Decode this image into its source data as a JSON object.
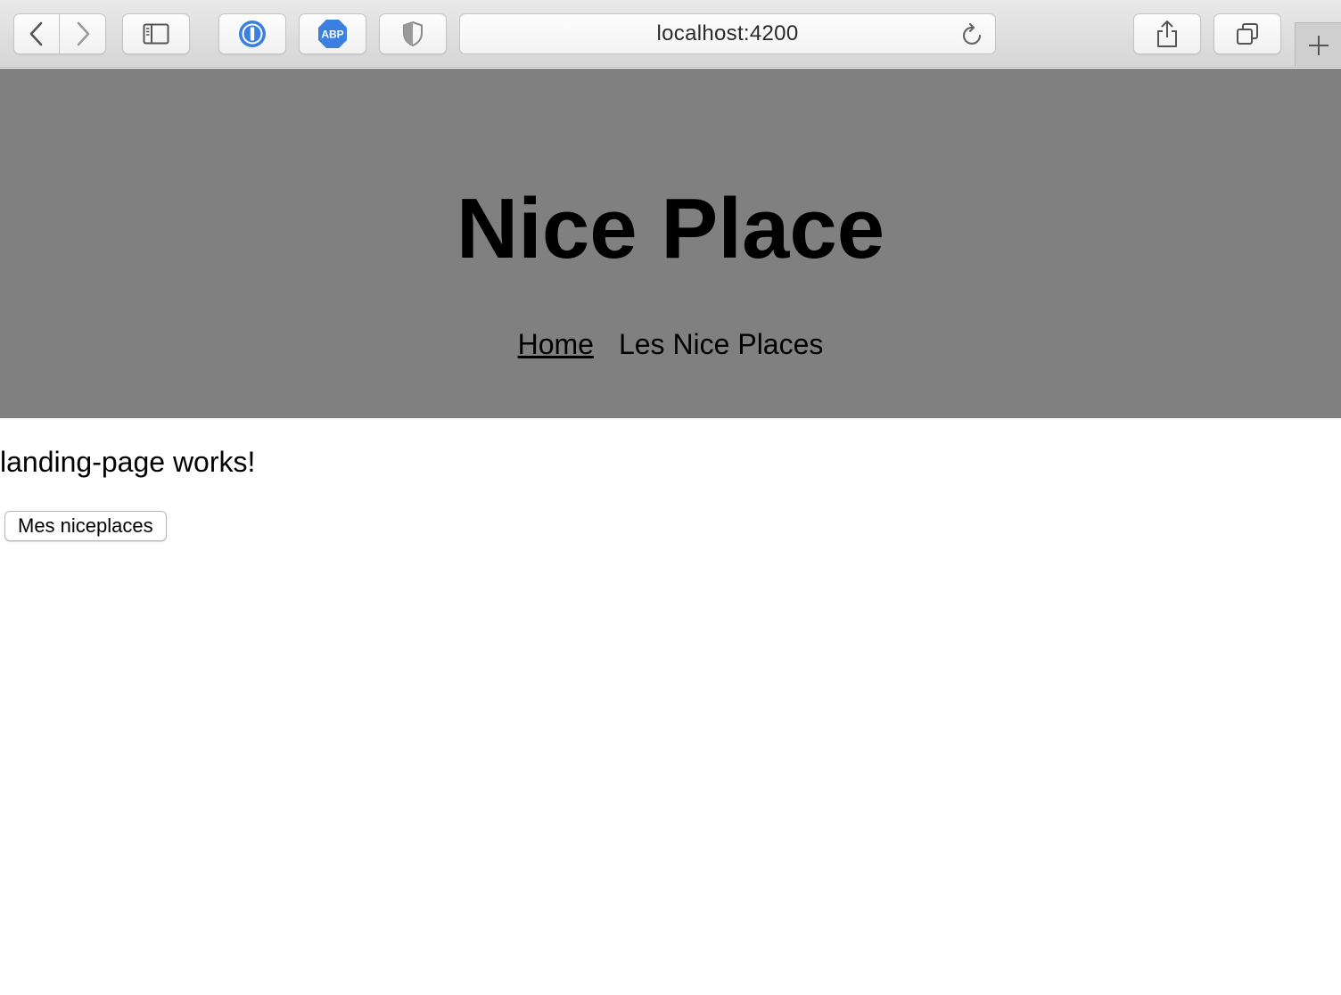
{
  "browser": {
    "url": "localhost:4200",
    "icons": {
      "back": "chevron-left-icon",
      "forward": "chevron-right-icon",
      "sidebar": "sidebar-icon",
      "password_manager": "1password-icon",
      "adblock": "abp-icon",
      "shield": "shield-icon",
      "reload": "reload-icon",
      "share": "share-icon",
      "tabs": "tabs-overview-icon",
      "new_tab": "plus-icon"
    },
    "abp_label": "ABP",
    "accent_blue": "#3b7fe0"
  },
  "header": {
    "title": "Nice Place",
    "background": "#808080",
    "nav": [
      {
        "label": "Home",
        "active": true
      },
      {
        "label": "Les Nice Places",
        "active": false
      }
    ]
  },
  "main": {
    "text": "landing-page works!",
    "button_label": "Mes niceplaces"
  }
}
